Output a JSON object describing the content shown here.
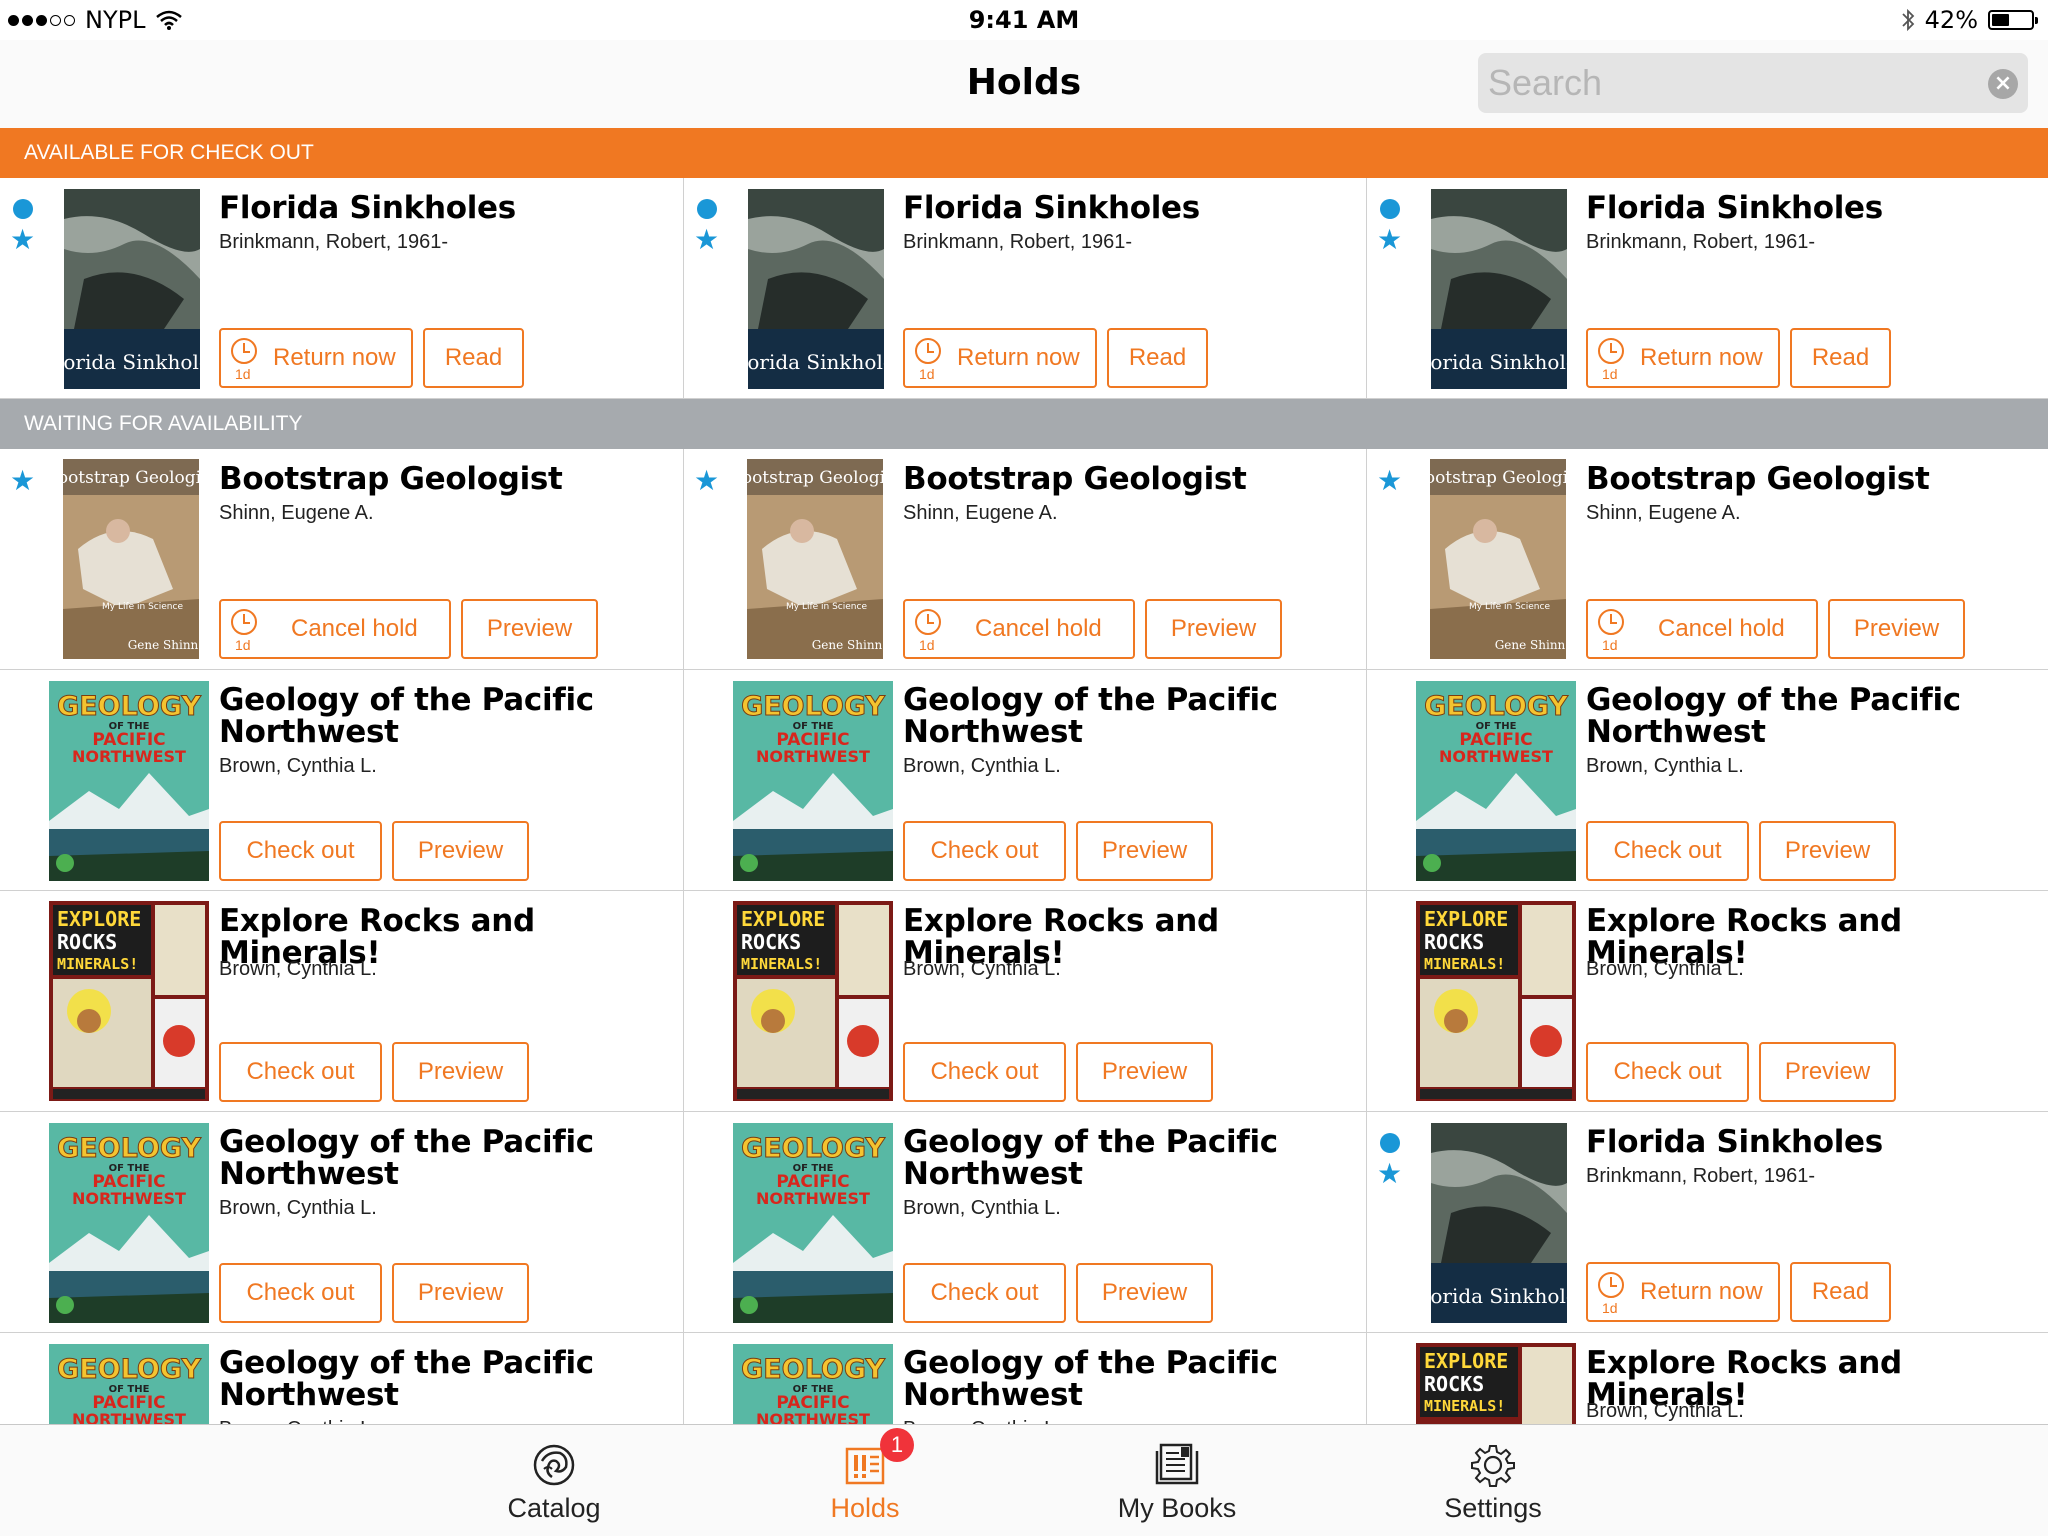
{
  "status_bar": {
    "carrier": "NYPL",
    "time": "9:41 AM",
    "battery": "42%"
  },
  "nav": {
    "title": "Holds",
    "search_placeholder": "Search"
  },
  "sections": {
    "available": "AVAILABLE FOR CHECK OUT",
    "waiting": "WAITING FOR AVAILABILITY"
  },
  "books": {
    "florida": {
      "title": "Florida Sinkholes",
      "author": "Brinkmann, Robert, 1961-",
      "cover_text": "Florida Sinkholes"
    },
    "bootstrap": {
      "title": "Bootstrap Geologist",
      "author": "Shinn, Eugene A.",
      "cover_text": "Bootstrap Geologist",
      "cover_caption": "My Life in Science",
      "cover_author": "Gene Shinn"
    },
    "pacific": {
      "title": "Geology of the Pacific Northwest",
      "author": "Brown, Cynthia L.",
      "cover_text_1": "GEOLOGY",
      "cover_text_2": "OF THE",
      "cover_text_3": "PACIFIC",
      "cover_text_4": "NORTHWEST"
    },
    "rocks": {
      "title": "Explore Rocks and Minerals!",
      "author": "Brown, Cynthia L.",
      "cover_text_1": "EXPLORE",
      "cover_text_2": "ROCKS",
      "cover_text_3": "MINERALS!"
    }
  },
  "buttons": {
    "return_now": "Return now",
    "read": "Read",
    "cancel_hold": "Cancel hold",
    "preview": "Preview",
    "check_out": "Check out",
    "days": "1d"
  },
  "tabs": [
    {
      "label": "Catalog",
      "icon": "catalog-lion-icon"
    },
    {
      "label": "Holds",
      "icon": "holds-icon",
      "badge": "1"
    },
    {
      "label": "My Books",
      "icon": "my-books-icon"
    },
    {
      "label": "Settings",
      "icon": "gear-icon"
    }
  ],
  "colors": {
    "accent": "#f07822",
    "blue": "#1a97d7",
    "waiting_header": "#a6aaae",
    "badge": "#f0333a"
  }
}
